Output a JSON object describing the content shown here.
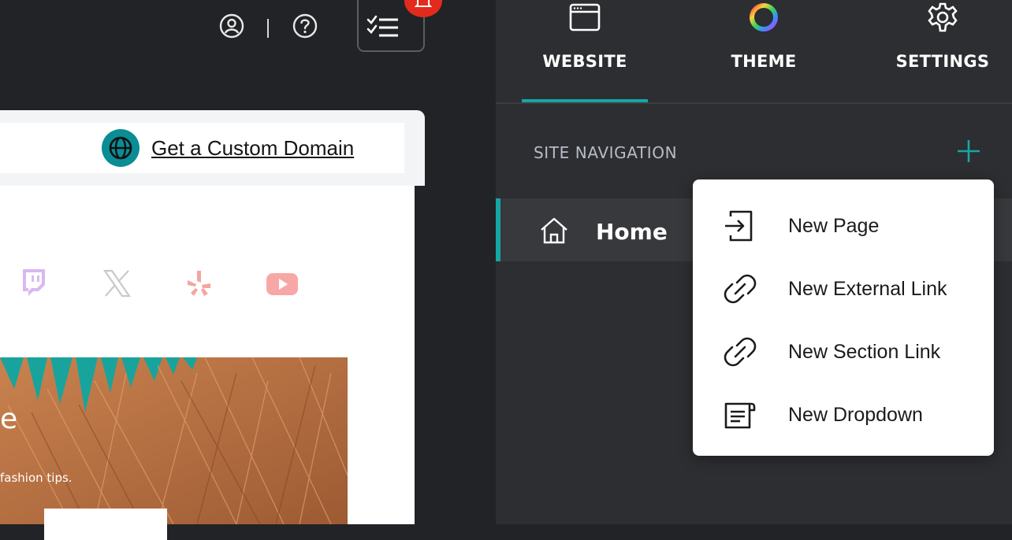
{
  "topbar": {
    "account_icon": "user-circle-icon",
    "help_icon": "question-circle-icon",
    "separator": "|",
    "checklist_icon": "checklist-icon",
    "notification_icon": "bell-icon"
  },
  "preview": {
    "domain_link": "Get a Custom Domain",
    "domain_icon": "globe-icon",
    "social_icons": [
      "twitch-icon",
      "x-icon",
      "yelp-icon",
      "youtube-icon"
    ],
    "hero_partial_heading": "e",
    "hero_partial_text": "fashion tips."
  },
  "panel": {
    "tabs": [
      {
        "label": "WEBSITE",
        "icon": "browser-window-icon",
        "active": true
      },
      {
        "label": "THEME",
        "icon": "color-wheel-icon",
        "active": false
      },
      {
        "label": "SETTINGS",
        "icon": "gear-icon",
        "active": false
      }
    ],
    "site_navigation_label": "SITE NAVIGATION",
    "add_icon": "plus-icon",
    "pages": [
      {
        "label": "Home",
        "icon": "home-icon"
      }
    ]
  },
  "add_menu": {
    "items": [
      {
        "label": "New Page",
        "icon": "new-page-icon"
      },
      {
        "label": "New External Link",
        "icon": "link-icon"
      },
      {
        "label": "New Section Link",
        "icon": "link-icon"
      },
      {
        "label": "New Dropdown",
        "icon": "dropdown-icon"
      }
    ]
  },
  "colors": {
    "accent": "#16a6a6",
    "panel_bg": "#2d2e31",
    "editor_bg": "#222326",
    "badge": "#e22b1d"
  }
}
